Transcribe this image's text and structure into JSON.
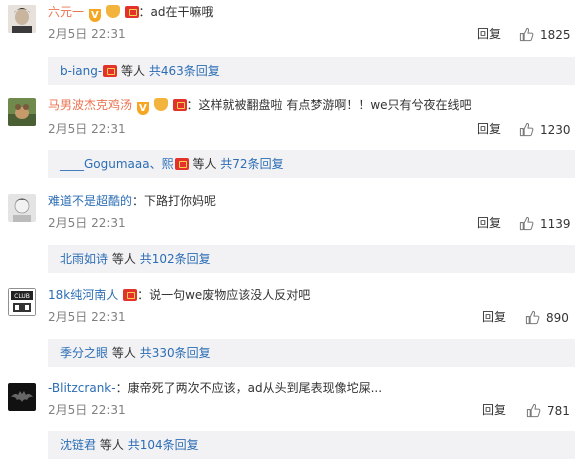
{
  "comments": [
    {
      "username": "六元一",
      "badges": [
        "v",
        "crown",
        "red"
      ],
      "sep": "：",
      "text": "ad在干嘛哦",
      "date": "2月5日 22:31",
      "reply_label": "回复",
      "likes": "1825",
      "replies": {
        "name": "b-iang-",
        "mid": "等人",
        "count": "共463条回复"
      }
    },
    {
      "username": "马男波杰克鸡汤",
      "badges": [
        "v",
        "crown",
        "red"
      ],
      "sep": "：",
      "text": "这样就被翻盘啦 有点梦游啊！！we只有兮夜在线吧",
      "date": "2月5日 22:31",
      "reply_label": "回复",
      "likes": "1230",
      "replies": {
        "name": "____Gogumaaa、熙",
        "mid": "等人",
        "count": "共72条回复"
      }
    },
    {
      "username": "难道不是超酷的",
      "badges": [],
      "sep": "：",
      "text": "下路打你妈呢",
      "date": "2月5日 22:31",
      "reply_label": "回复",
      "likes": "1139",
      "replies": {
        "name": "北雨如诗",
        "mid": "等人",
        "count": "共102条回复"
      }
    },
    {
      "username": "18k纯河南人",
      "badges": [
        "red"
      ],
      "sep": "：",
      "text": "说一句we废物应该没人反对吧",
      "date": "2月5日 22:31",
      "reply_label": "回复",
      "likes": "890",
      "replies": {
        "name": "季分之眼",
        "mid": "等人",
        "count": "共330条回复"
      }
    },
    {
      "username": "-Blitzcrank-",
      "badges": [],
      "sep": "：",
      "text": "康帝死了两次不应该，ad从头到尾表现像坨屎...",
      "date": "2月5日 22:31",
      "reply_label": "回复",
      "likes": "781",
      "replies": {
        "name": "沈链君",
        "mid": "等人",
        "count": "共104条回复"
      }
    }
  ],
  "icons": {
    "like": "thumbs-up-icon"
  },
  "colors": {
    "username": "#eb7350",
    "link": "#2b6db4",
    "time": "#808080",
    "reply_bg": "#f2f2f5"
  }
}
